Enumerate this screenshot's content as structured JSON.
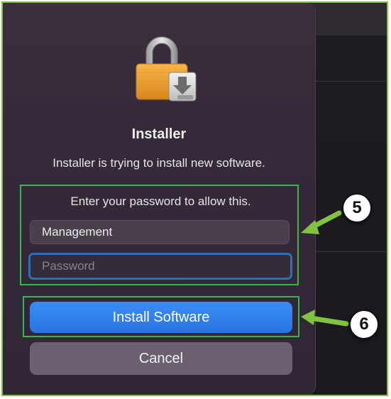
{
  "dialog": {
    "icon": "lock-with-installer-icon",
    "title": "Installer",
    "message": "Installer is trying to install new software.",
    "prompt": "Enter your password to allow this.",
    "username_value": "Management",
    "password_placeholder": "Password",
    "install_label": "Install Software",
    "cancel_label": "Cancel"
  },
  "callouts": {
    "step_five": "5",
    "step_six": "6"
  },
  "colors": {
    "highlight_box": "#34b84a",
    "arrow": "#7fc341",
    "primary_button": "#2f7fe8",
    "focus_ring": "#2f6fb6"
  }
}
